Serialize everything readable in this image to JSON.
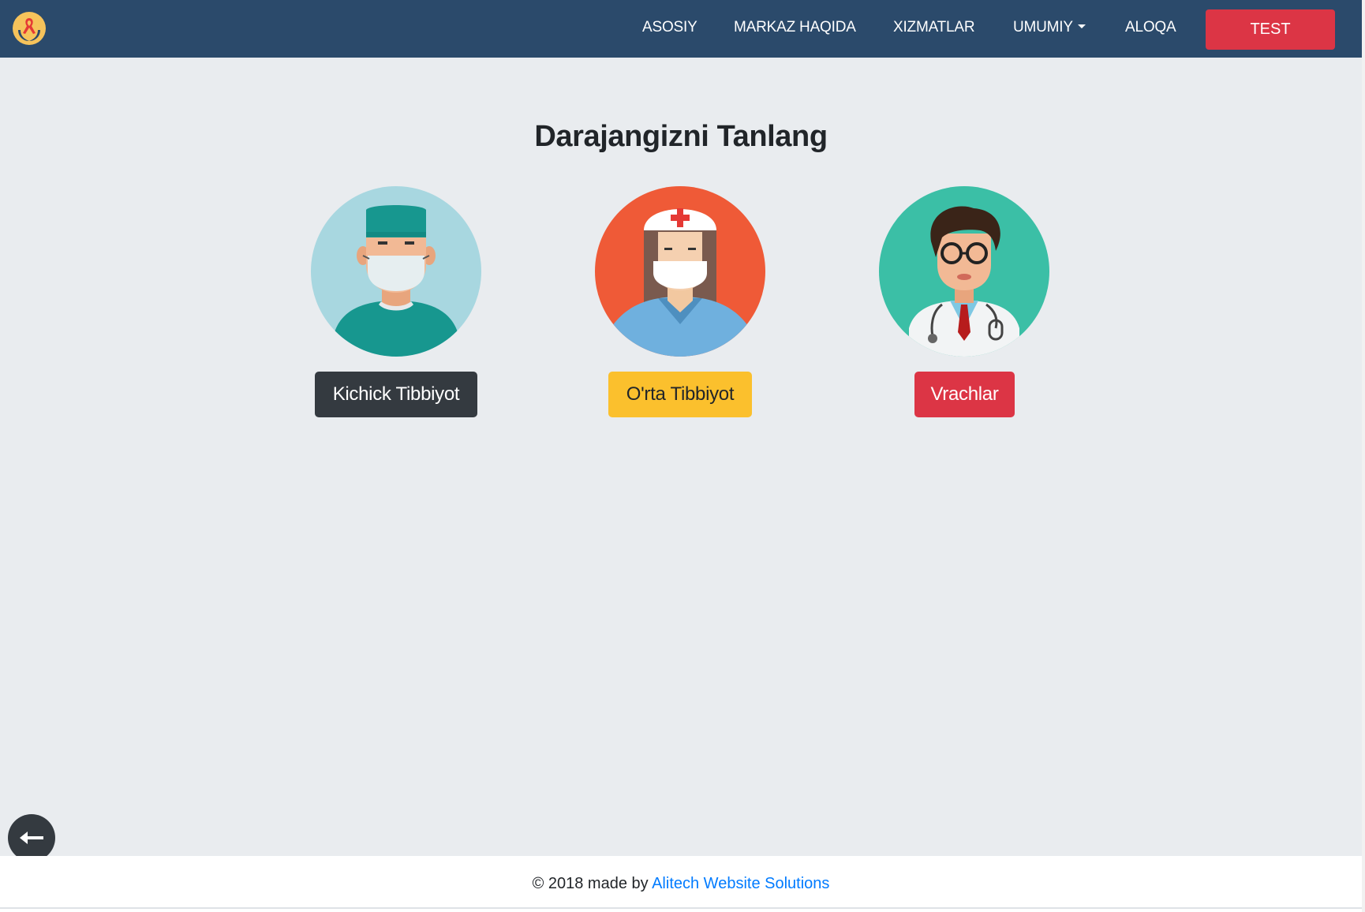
{
  "navbar": {
    "logo_icon": "ribbon-hands-logo-icon",
    "links": [
      "ASOSIY",
      "MARKAZ HAQIDA",
      "XIZMATLAR",
      "UMUMIY",
      "ALOQA"
    ],
    "test_button": "TEST"
  },
  "main": {
    "title": "Darajangizni Tanlang",
    "levels": [
      {
        "label": "Kichick Tibbiyot",
        "icon": "surgeon-avatar-icon",
        "button_color": "#343a40",
        "avatar_color": "#a8d7e0"
      },
      {
        "label": "O'rta Tibbiyot",
        "icon": "nurse-avatar-icon",
        "button_color": "#fbc02d",
        "avatar_color": "#ef5a37"
      },
      {
        "label": "Vrachlar",
        "icon": "doctor-avatar-icon",
        "button_color": "#dc3545",
        "avatar_color": "#3bbfa6"
      }
    ]
  },
  "back_button": {
    "icon": "arrow-left-icon"
  },
  "footer": {
    "text": "© 2018 made by",
    "link": "Alitech Website Solutions"
  },
  "colors": {
    "navbar": "#2b4a6b",
    "background": "#e9ecef",
    "link": "#007bff",
    "danger": "#dc3545"
  }
}
